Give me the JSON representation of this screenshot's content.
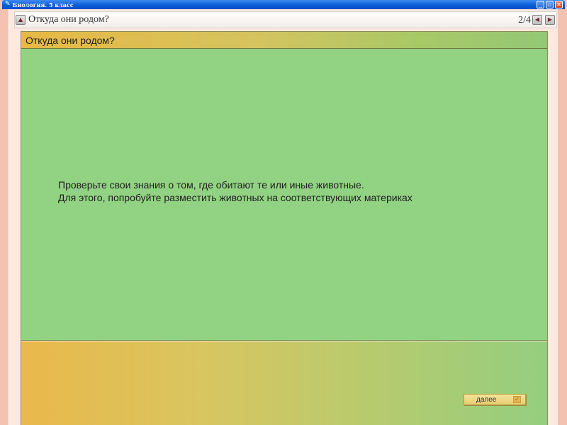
{
  "window": {
    "title": "Биология. 5 класс",
    "controls": {
      "minimize": "_",
      "maximize": "▫",
      "close": "✕"
    }
  },
  "lesson_bar": {
    "title": "Откуда они родом?",
    "page_counter": "2/4",
    "icons": {
      "up": "up-triangle-icon",
      "prev": "left-triangle-icon",
      "next": "right-triangle-icon"
    }
  },
  "slide": {
    "header_title": "Откуда они родом?",
    "text_lines": [
      "Проверьте свои знания о том, где обитают те или иные животные.",
      "Для этого, попробуйте разместить животных  на соответствующих материках"
    ],
    "next_button_label": "далее",
    "next_button_icon": "checkbox-icon"
  },
  "colors": {
    "slide_background": "#92d283",
    "title_bar": "#0b5ed8",
    "frame": "#f3c2b0"
  }
}
